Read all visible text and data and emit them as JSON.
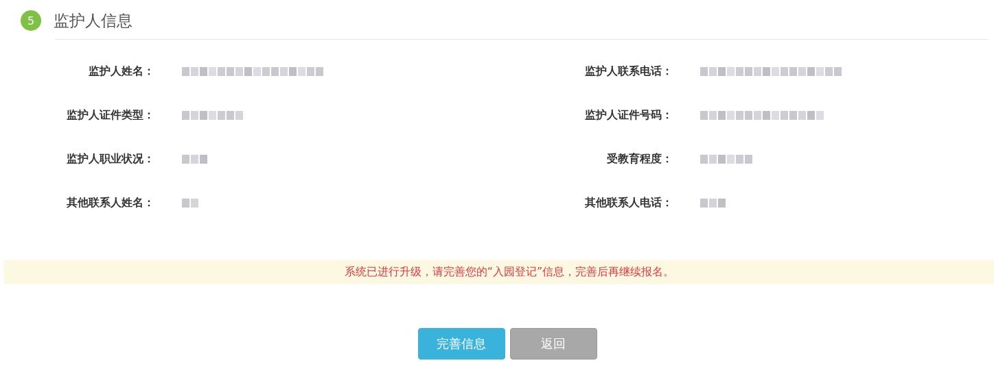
{
  "section": {
    "number": "5",
    "title": "监护人信息"
  },
  "fields": [
    {
      "label": "监护人姓名："
    },
    {
      "label": "监护人联系电话："
    },
    {
      "label": "监护人证件类型："
    },
    {
      "label": "监护人证件号码："
    },
    {
      "label": "监护人职业状况："
    },
    {
      "label": "受教育程度："
    },
    {
      "label": "其他联系人姓名："
    },
    {
      "label": "其他联系人电话："
    }
  ],
  "notice": "系统已进行升级，请完善您的“入园登记”信息，完善后再继续报名。",
  "buttons": [
    {
      "label": "完善信息",
      "kind": "primary"
    },
    {
      "label": "返回",
      "kind": "secondary"
    }
  ]
}
